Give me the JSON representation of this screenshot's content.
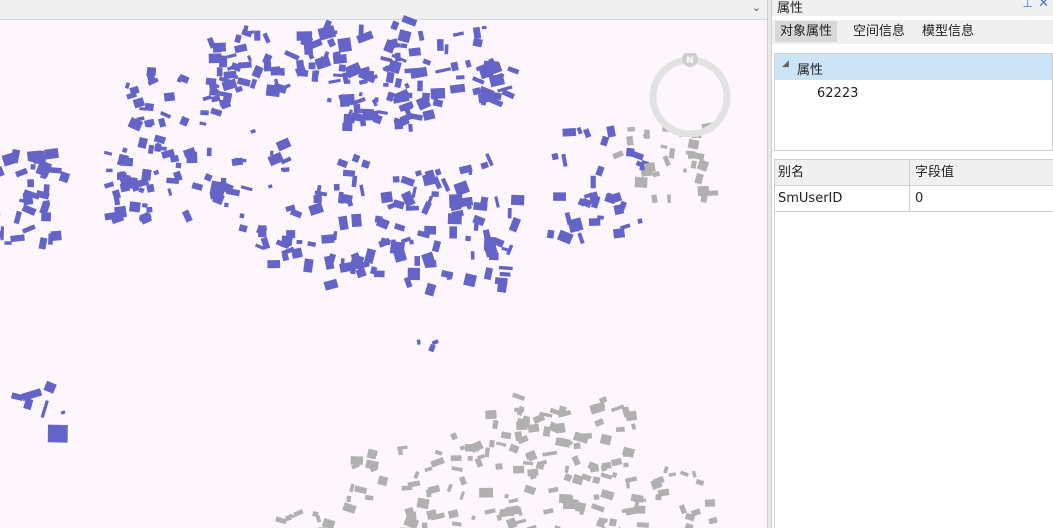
{
  "scene": {
    "compass_label": "N",
    "colors": {
      "background": "#fdf7fd",
      "selected_buildings": "#6464c8",
      "other_buildings": "#b0b0b0",
      "compass": "#e2e2e2"
    }
  },
  "panel": {
    "title": "属性",
    "tabs": [
      {
        "label": "对象属性",
        "active": true
      },
      {
        "label": "空间信息",
        "active": false
      },
      {
        "label": "模型信息",
        "active": false
      }
    ],
    "tree": {
      "root_label": "属性",
      "child_label": "62223"
    },
    "grid": {
      "columns": [
        "别名",
        "字段值"
      ],
      "rows": [
        {
          "alias": "SmUserID",
          "value": "0"
        }
      ]
    }
  }
}
